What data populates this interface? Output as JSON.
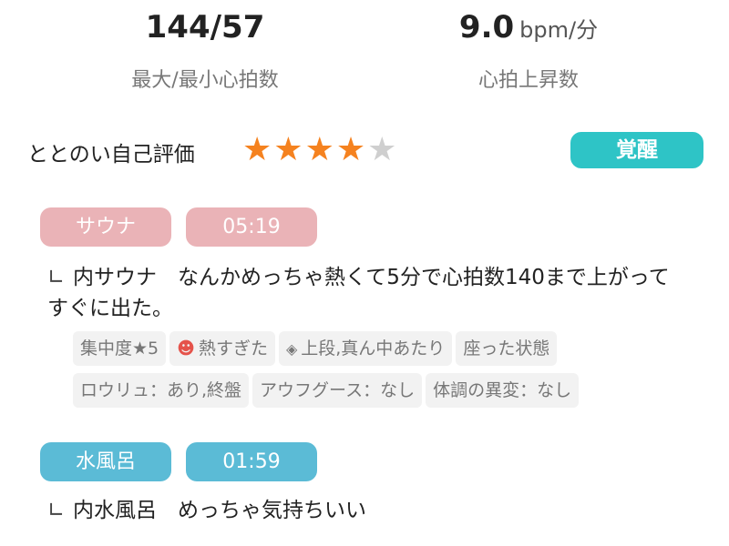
{
  "summary": {
    "heart_rate": {
      "value": "144/57",
      "label": "最大/最小心拍数"
    },
    "rise": {
      "value": "9.0",
      "unit": "bpm/分",
      "label": "心拍上昇数"
    }
  },
  "rating": {
    "label": "ととのい自己評価",
    "stars_filled": 4,
    "stars_total": 5,
    "state_badge": "覚醒",
    "colors": {
      "star_on": "#f5821f",
      "star_off": "#cfcfcf",
      "badge": "#2ec4c6"
    }
  },
  "sessions": [
    {
      "type_label": "サウナ",
      "duration": "05:19",
      "note_mark": "∟",
      "note": "内サウナ　なんかめっちゃ熱くて5分で心拍数140まで上がってすぐに出た。",
      "tags": [
        {
          "icon": "",
          "text": "集中度★5"
        },
        {
          "icon": "hot-face-icon",
          "text": "熱すぎた"
        },
        {
          "icon": "layers-icon",
          "text": "上段,真ん中あたり"
        },
        {
          "icon": "",
          "text": "座った状態"
        },
        {
          "icon": "",
          "text": "ロウリュ：あり,終盤"
        },
        {
          "icon": "",
          "text": "アウフグース：なし"
        },
        {
          "icon": "",
          "text": "体調の異変：なし"
        }
      ],
      "color": "#eab3b7"
    },
    {
      "type_label": "水風呂",
      "duration": "01:59",
      "note_mark": "∟",
      "note": "内水風呂　めっちゃ気持ちいい",
      "color": "#5bbbd6"
    }
  ]
}
